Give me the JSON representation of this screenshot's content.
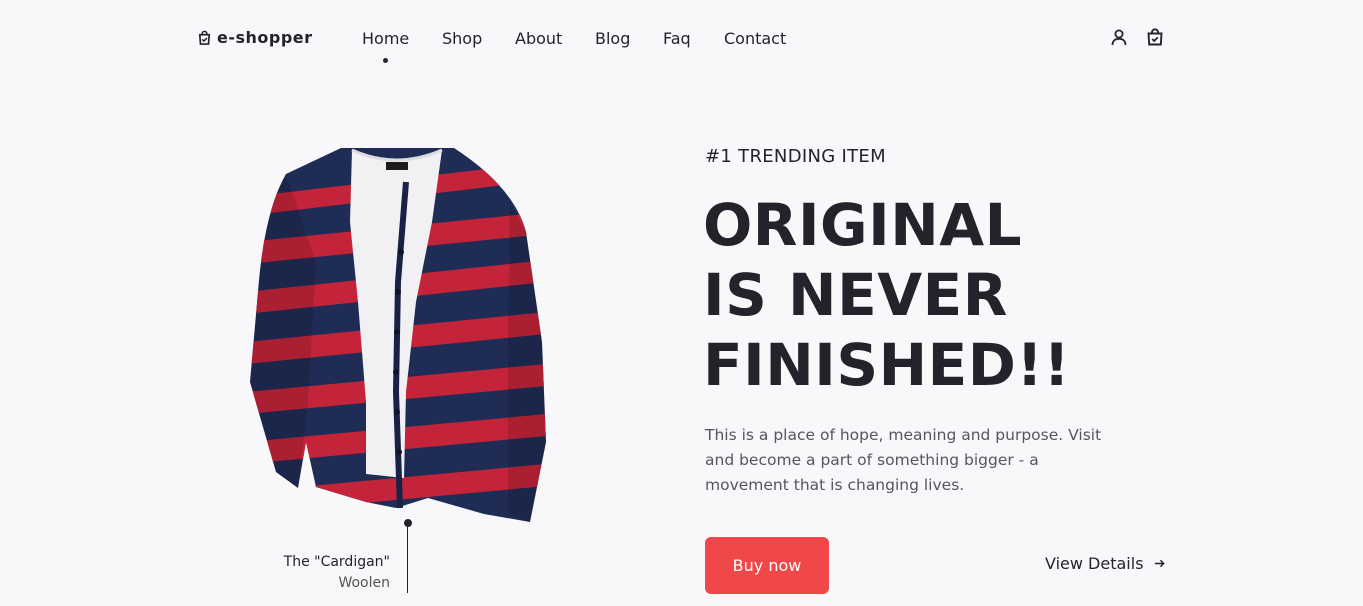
{
  "header": {
    "logo_text": "e-shopper",
    "logo_icon": "shopping-bag-icon",
    "nav": [
      {
        "label": "Home",
        "active": true
      },
      {
        "label": "Shop"
      },
      {
        "label": "About"
      },
      {
        "label": "Blog"
      },
      {
        "label": "Faq"
      },
      {
        "label": "Contact"
      }
    ],
    "icons": [
      "user-icon",
      "shopping-bag-check-icon"
    ]
  },
  "product": {
    "name": "The \"Cardigan\"",
    "material": "Woolen",
    "image": "striped-cardigan-image"
  },
  "hero": {
    "eyebrow": "#1 TRENDING ITEM",
    "headline": [
      "ORIGINAL",
      "IS NEVER",
      "FINISHED!!"
    ],
    "description": "This is a place of hope, meaning and purpose. Visit and become a part of something bigger - a movement that is changing lives.",
    "buy_label": "Buy now",
    "details_label": "View Details",
    "details_icon": "arrow-right-icon"
  },
  "colors": {
    "accent": "#f04848",
    "text": "#23232b",
    "background": "#f8f8fb",
    "cardigan_navy": "#1f2c55",
    "cardigan_red": "#c3243a"
  }
}
